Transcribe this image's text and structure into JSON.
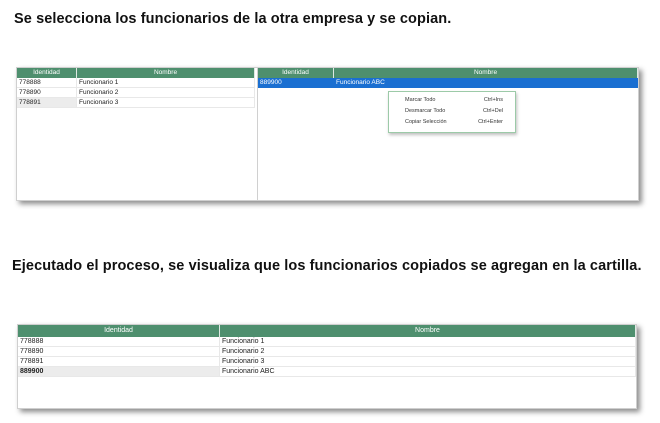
{
  "heading_top": "Se selecciona los funcionarios de la otra empresa y se copian.",
  "heading_bottom": "Ejecutado el proceso, se visualiza que los funcionarios copiados se agregan en la cartilla.",
  "source_grid": {
    "columns": [
      "Identidad",
      "Nombre"
    ],
    "rows": [
      {
        "id": "778888",
        "name": "Funcionario 1"
      },
      {
        "id": "778890",
        "name": "Funcionario 2"
      },
      {
        "id": "778891",
        "name": "Funcionario 3"
      }
    ]
  },
  "other_company_grid": {
    "columns": [
      "Identidad",
      "Nombre"
    ],
    "rows": [
      {
        "id": "889900",
        "name": "Funcionario ABC",
        "selected": true
      }
    ]
  },
  "context_menu": {
    "items": [
      {
        "label": "Marcar Todo",
        "shortcut": "Ctrl+Ins"
      },
      {
        "label": "Desmarcar Todo",
        "shortcut": "Ctrl+Del"
      },
      {
        "label": "Copiar Selección",
        "shortcut": "Ctrl+Enter"
      }
    ]
  },
  "result_grid": {
    "columns": [
      "Identidad",
      "Nombre"
    ],
    "rows": [
      {
        "id": "778888",
        "name": "Funcionario 1"
      },
      {
        "id": "778890",
        "name": "Funcionario 2"
      },
      {
        "id": "778891",
        "name": "Funcionario 3"
      },
      {
        "id": "889900",
        "name": "Funcionario ABC"
      }
    ]
  },
  "colors": {
    "header_green": "#4e8f6e",
    "selection_blue": "#1a6fd1",
    "menu_border": "#9ccaa8"
  }
}
